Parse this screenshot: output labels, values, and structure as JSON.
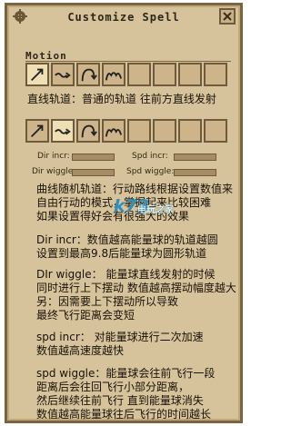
{
  "window": {
    "title": "Customize Spell"
  },
  "motion": {
    "label": "Motion",
    "slots_row1": [
      {
        "icon": "straight-arrow-icon",
        "active": true
      },
      {
        "icon": "wave-arrow-icon",
        "active": false
      },
      {
        "icon": "curve-arrow-icon",
        "active": false
      },
      {
        "icon": "loop-arrow-icon",
        "active": false
      },
      {
        "icon": "",
        "active": false
      },
      {
        "icon": "",
        "active": false
      },
      {
        "icon": "",
        "active": false
      },
      {
        "icon": "",
        "active": false
      }
    ],
    "description1": "直线轨道：普通的轨道 往前方直线发射",
    "slots_row2": [
      {
        "icon": "straight-arrow-icon",
        "active": false
      },
      {
        "icon": "wave-arrow-icon",
        "active": true
      },
      {
        "icon": "curve-arrow-icon",
        "active": false
      },
      {
        "icon": "loop-arrow-icon",
        "active": false
      },
      {
        "icon": "",
        "active": false
      },
      {
        "icon": "",
        "active": false
      },
      {
        "icon": "",
        "active": false
      },
      {
        "icon": "",
        "active": false
      }
    ]
  },
  "params": {
    "dir_incr": "Dir incr:",
    "spd_incr": "Spd incr:",
    "dir_wiggle": "Dir wiggle:",
    "spd_wiggle": "Spd wiggle:"
  },
  "explanations": {
    "random_track": [
      "曲线随机轨道：行动路线根据设置数值来",
      "自由行动的模式，掌握起来比较困难",
      "如果设置得好会有很强大的效果"
    ],
    "dir_incr": [
      "Dir incr：数值越高能量球的轨道越圆",
      "设置到最高9.8后能量球为圆形轨道"
    ],
    "dir_wiggle": [
      "DIr wiggle： 能量球直线发射的时候",
      "同时进行上下摆动 数值越高摆动幅度越大",
      "另：因需要上下摆动所以导致",
      "最终飞行距离会变短"
    ],
    "spd_incr": [
      "spd incr： 对能量球进行二次加速",
      "数值越高速度越快"
    ],
    "spd_wiggle": [
      "spd wiggle：能量球会往前飞行一段",
      "距离后会往回飞行小部分距离，",
      "然后继续往前飞行 直到能量球消失",
      "数值越高能量球往后飞行的时间越长"
    ]
  },
  "watermark": {
    "logo": "k73",
    "text": "电玩之家"
  },
  "colors": {
    "parchment": "#d7c39b",
    "border": "#7a6442",
    "slot_active": "#eee0b4"
  }
}
